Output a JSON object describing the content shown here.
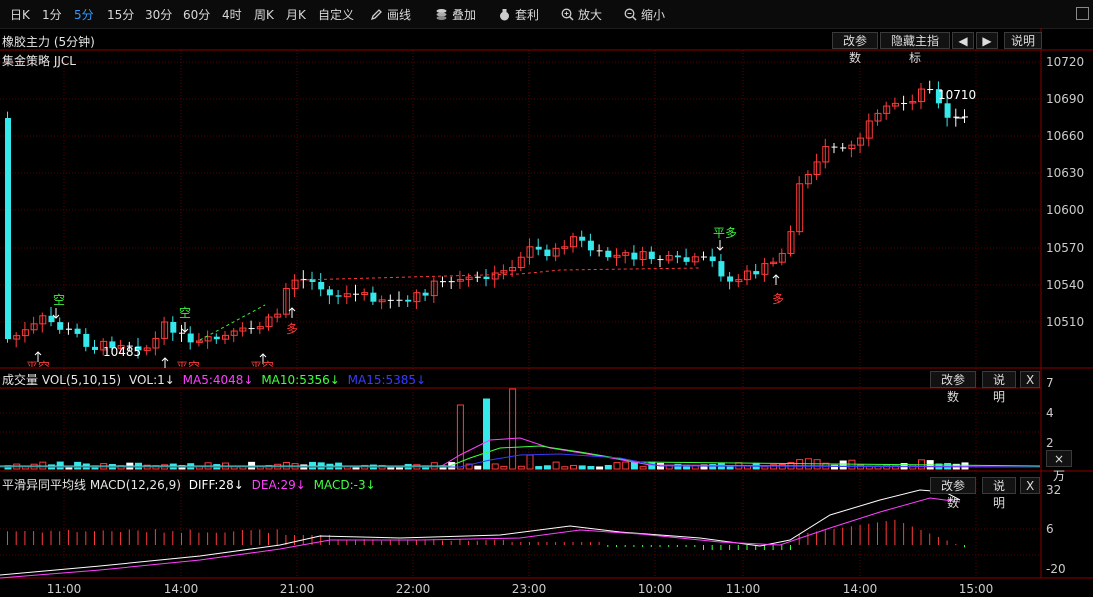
{
  "toolbar": {
    "periods": [
      "日K",
      "1分",
      "5分",
      "15分",
      "30分",
      "60分",
      "4时",
      "周K",
      "月K",
      "自定义"
    ],
    "active_period": "5分",
    "tools": [
      {
        "label": "画线",
        "icon": "pencil-icon"
      },
      {
        "label": "叠加",
        "icon": "stack-icon"
      },
      {
        "label": "套利",
        "icon": "money-bag-icon"
      },
      {
        "label": "放大",
        "icon": "zoom-in-icon"
      },
      {
        "label": "缩小",
        "icon": "zoom-out-icon"
      }
    ]
  },
  "main": {
    "title": "橡胶主力 (5分钟)",
    "strategy": "集金策略 JJCL",
    "buttons": {
      "params": "改参数",
      "hide": "隐藏主指标",
      "prev": "◀",
      "next": "▶",
      "help": "说明"
    },
    "price_axis": [
      "10720",
      "10690",
      "10660",
      "10630",
      "10600",
      "10570",
      "10540",
      "10510"
    ],
    "annot_high": "10710",
    "annot_low": "10485",
    "signals": {
      "short": "空",
      "long": "多",
      "close_long": "平多",
      "close_short": "平空"
    }
  },
  "volume": {
    "title": "成交量 VOL(5,10,15)",
    "vol": "VOL:1↓",
    "ma5": "MA5:4048↓",
    "ma10": "MA10:5356↓",
    "ma15": "MA15:5385↓",
    "buttons": {
      "params": "改参数",
      "help": "说明",
      "close": "X"
    },
    "axis": [
      "7",
      "4",
      "2"
    ],
    "unit": "×万"
  },
  "macd": {
    "title": "平滑异同平均线 MACD(12,26,9)",
    "diff": "DIFF:28↓",
    "dea": "DEA:29↓",
    "macd": "MACD:-3↓",
    "buttons": {
      "params": "改参数",
      "help": "说明",
      "close": "X"
    },
    "axis": [
      "32",
      "6",
      "-20"
    ]
  },
  "time_axis": [
    "11:00",
    "14:00",
    "21:00",
    "22:00",
    "23:00",
    "10:00",
    "11:00",
    "14:00",
    "15:00"
  ],
  "colors": {
    "up": "#ff3b3b",
    "down": "#35e8ec",
    "flat": "#ffffff",
    "ma5": "#ff40ff",
    "ma10": "#40ff40",
    "ma15": "#3a3aff",
    "accent": "#2e9bff"
  }
}
